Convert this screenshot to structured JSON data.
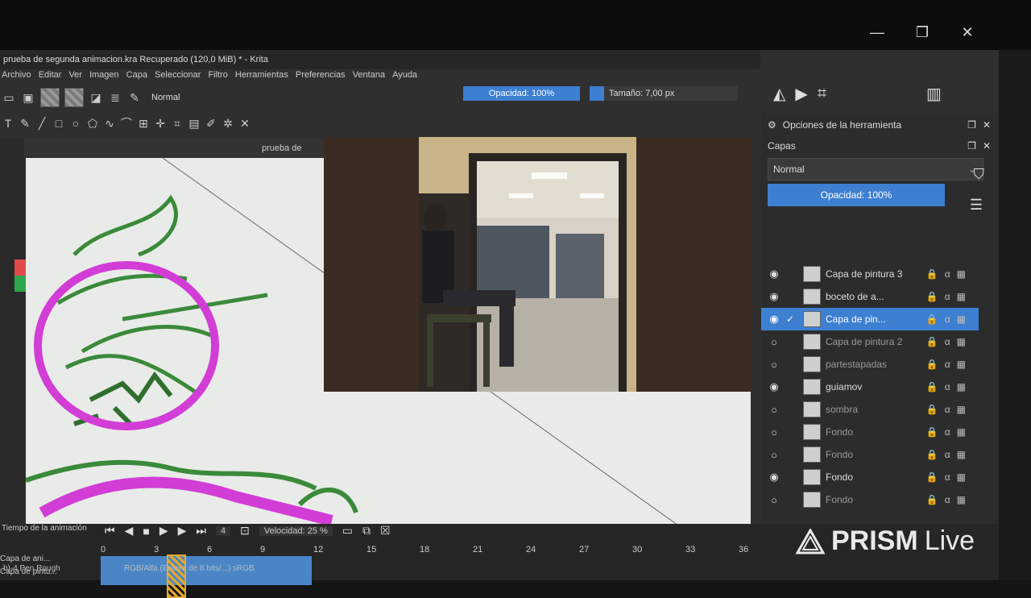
{
  "window": {
    "title": "prueba de segunda animacion.kra Recuperado (120,0 MiB) * - Krita",
    "controls": [
      "—",
      "❐",
      "✕"
    ]
  },
  "menu": [
    "Archivo",
    "Editar",
    "Ver",
    "Imagen",
    "Capa",
    "Seleccionar",
    "Filtro",
    "Herramientas",
    "Preferencias",
    "Ventana",
    "Ayuda"
  ],
  "toolbar": {
    "blend_mode": "Normal",
    "opacity": "Opacidad: 100%",
    "size": "Tamaño: 7,00 px"
  },
  "document": {
    "tab_label": "prueba de segunda"
  },
  "panel": {
    "tool_options": "Opciones de la herramienta",
    "layers_title": "Capas",
    "blend_mode": "Normal",
    "opacity": "Opacidad:  100%",
    "layers": [
      {
        "name": "Capa de pintura 3",
        "visible": true,
        "selected": false
      },
      {
        "name": "boceto de a...",
        "visible": true,
        "selected": false
      },
      {
        "name": "Capa de pin...",
        "visible": true,
        "selected": true
      },
      {
        "name": "Capa de pintura 2",
        "visible": false,
        "selected": false
      },
      {
        "name": "partestapadas",
        "visible": false,
        "selected": false
      },
      {
        "name": "guiamov",
        "visible": true,
        "selected": false
      },
      {
        "name": "sombra",
        "visible": false,
        "selected": false
      },
      {
        "name": "Fondo",
        "visible": false,
        "selected": false
      },
      {
        "name": "Fondo",
        "visible": false,
        "selected": false
      },
      {
        "name": "Fondo",
        "visible": true,
        "selected": false
      },
      {
        "name": "Fondo",
        "visible": false,
        "selected": false
      }
    ]
  },
  "timeline": {
    "title": "Tiempo de la animación",
    "frame": "4",
    "speed": "Velocidad: 25 %",
    "rows": [
      "Capa de ani...",
      "Capa de pintu..."
    ],
    "numbers": [
      "0",
      "3",
      "6",
      "9",
      "12",
      "15",
      "18",
      "21",
      "24",
      "27",
      "30",
      "33",
      "36"
    ],
    "current_frame": 4
  },
  "status": {
    "brush": "b)-4 Pen Rough",
    "color_model": "RGB/Alfa (Entero de 8 bits/...) sRGB"
  },
  "watermark": {
    "bold": "PRISM",
    "light": "Live"
  },
  "colors": {
    "accent": "#3d7fd0",
    "magenta": "#d23dd6",
    "green": "#3a8a3a"
  }
}
